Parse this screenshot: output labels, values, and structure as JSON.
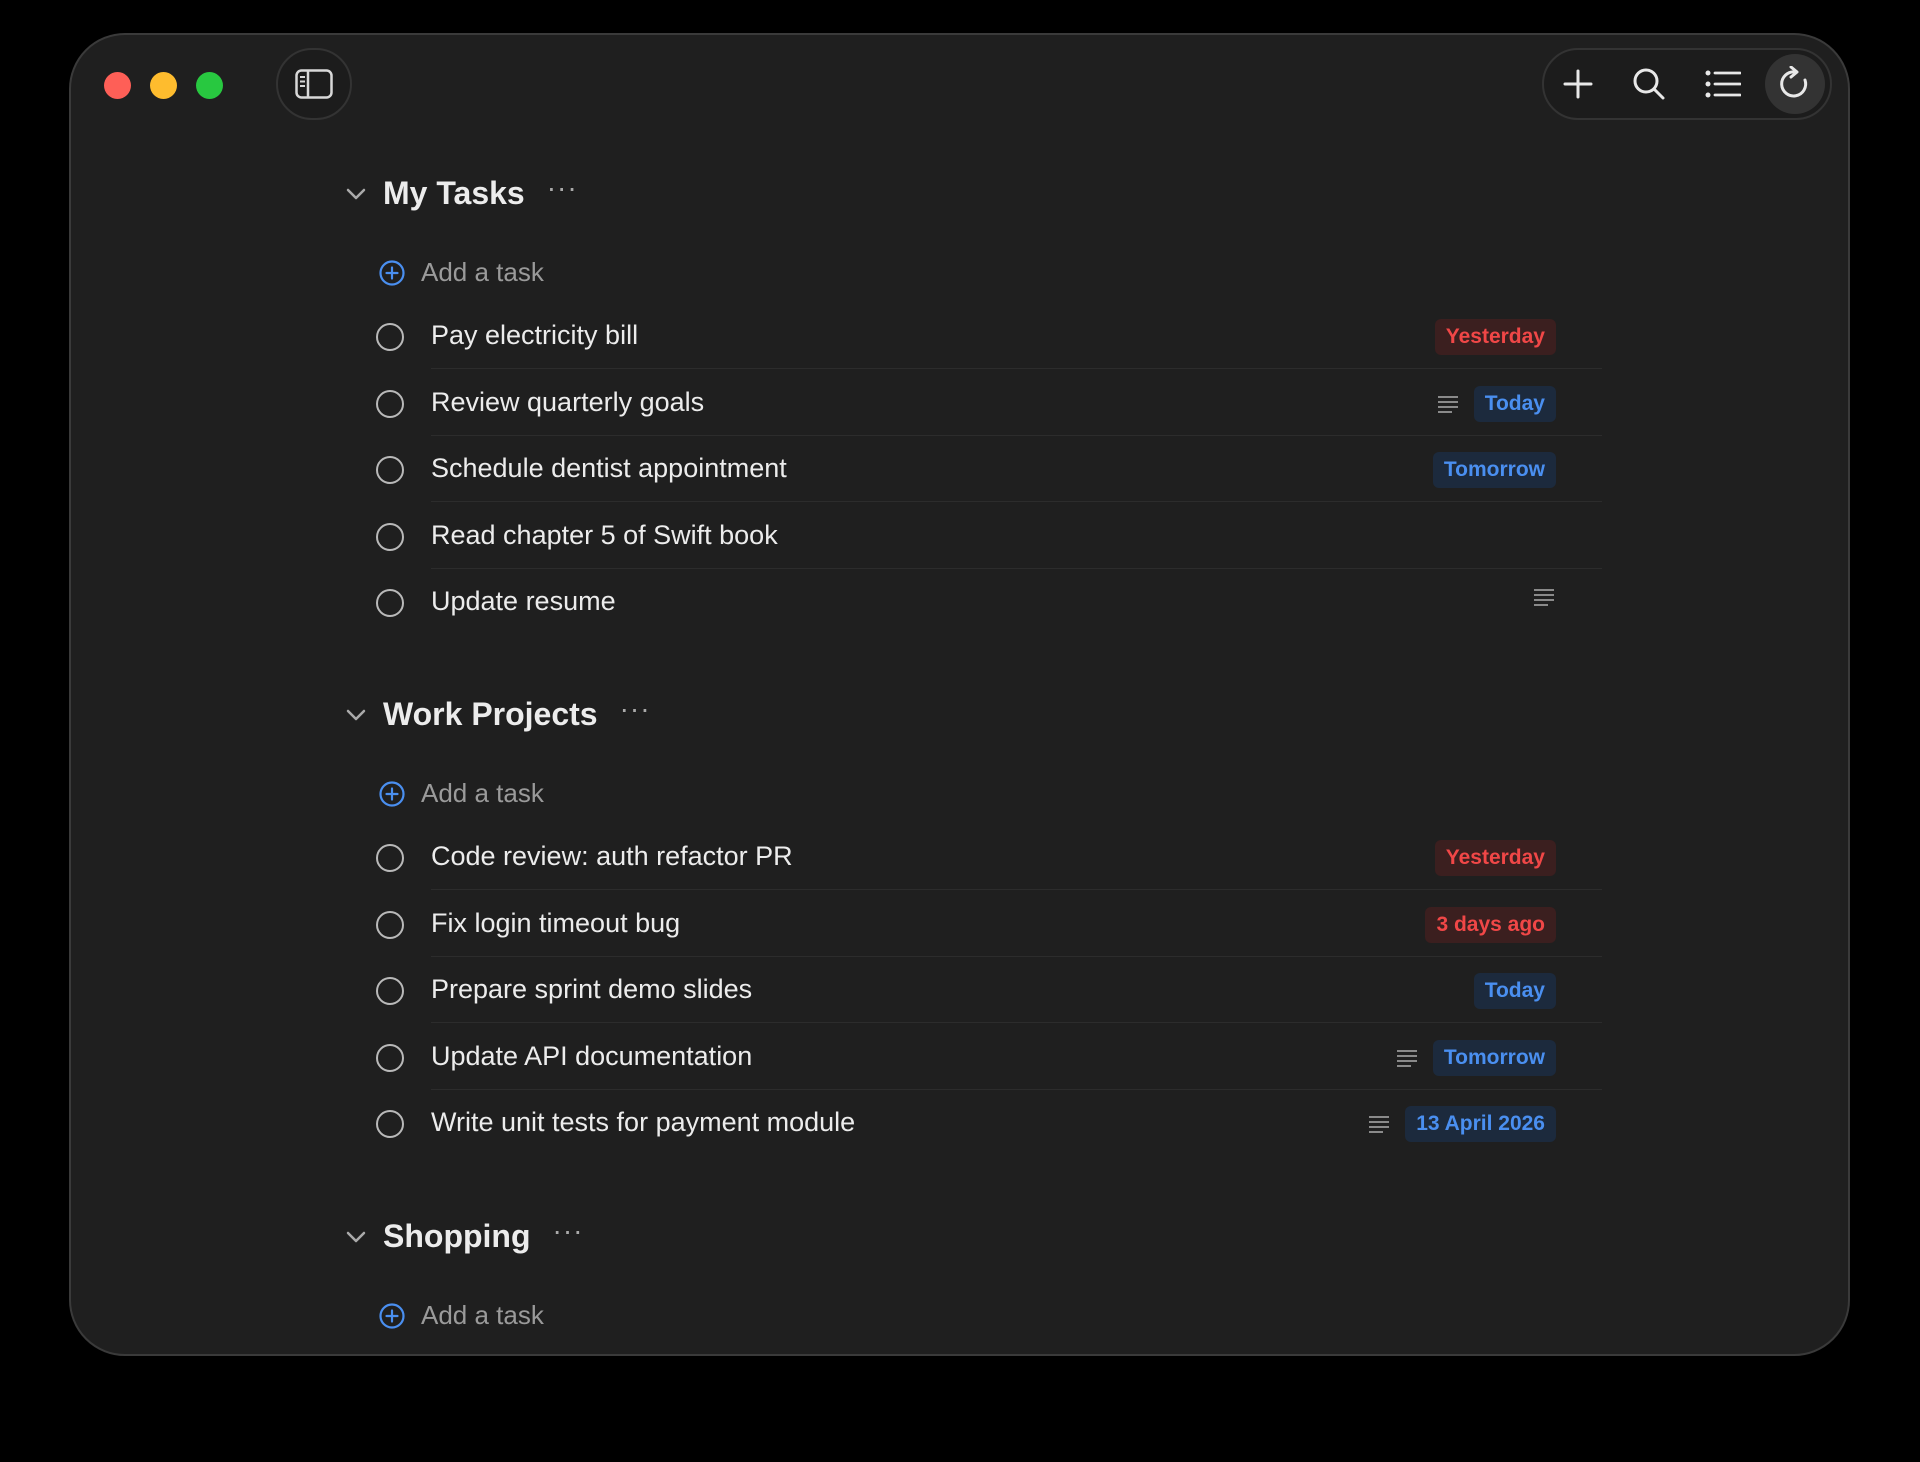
{
  "window": {
    "toolbar": {
      "add_icon": "plus-icon",
      "search_icon": "search-icon",
      "list_icon": "list-icon",
      "refresh_icon": "refresh-icon"
    }
  },
  "colors": {
    "overdue": "#f04747",
    "upcoming": "#4a8ff0",
    "accent": "#4a8ff0"
  },
  "sections": [
    {
      "title": "My Tasks",
      "more_label": "···",
      "add_label": "Add a task",
      "tasks": [
        {
          "title": "Pay electricity bill",
          "due": "Yesterday",
          "due_status": "red",
          "has_note": false
        },
        {
          "title": "Review quarterly goals",
          "due": "Today",
          "due_status": "blue",
          "has_note": true
        },
        {
          "title": "Schedule dentist appointment",
          "due": "Tomorrow",
          "due_status": "blue",
          "has_note": false
        },
        {
          "title": "Read chapter 5 of Swift book",
          "due": "",
          "due_status": "",
          "has_note": false
        },
        {
          "title": "Update resume",
          "due": "",
          "due_status": "",
          "has_note": true
        }
      ]
    },
    {
      "title": "Work Projects",
      "more_label": "···",
      "add_label": "Add a task",
      "tasks": [
        {
          "title": "Code review: auth refactor PR",
          "due": "Yesterday",
          "due_status": "red",
          "has_note": false
        },
        {
          "title": "Fix login timeout bug",
          "due": "3 days ago",
          "due_status": "red",
          "has_note": false
        },
        {
          "title": "Prepare sprint demo slides",
          "due": "Today",
          "due_status": "blue",
          "has_note": false
        },
        {
          "title": "Update API documentation",
          "due": "Tomorrow",
          "due_status": "blue",
          "has_note": true
        },
        {
          "title": "Write unit tests for payment module",
          "due": "13 April 2026",
          "due_status": "blue",
          "has_note": true
        }
      ]
    },
    {
      "title": "Shopping",
      "more_label": "···",
      "add_label": "Add a task",
      "tasks": []
    }
  ]
}
